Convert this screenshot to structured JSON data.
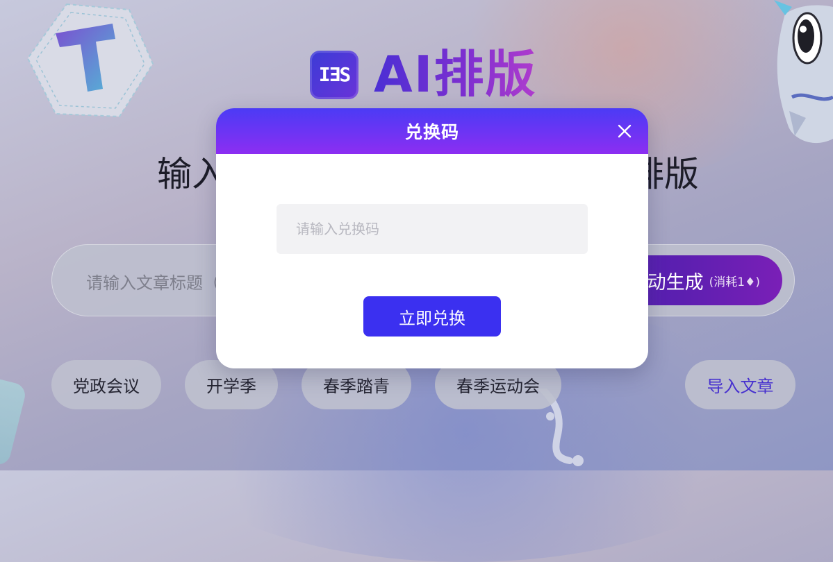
{
  "logo": {
    "icon_text": "ΙƎЅ",
    "title": "AI排版"
  },
  "headline": {
    "left_fragment": "输入",
    "right_fragment": "排版"
  },
  "search": {
    "placeholder": "请输入文章标题（",
    "generate_label": "动生成",
    "generate_cost": "(消耗1♦)"
  },
  "tags": [
    {
      "label": "党政会议"
    },
    {
      "label": "开学季"
    },
    {
      "label": "春季踏青"
    },
    {
      "label": "春季运动会"
    }
  ],
  "import_label": "导入文章",
  "modal": {
    "title": "兑换码",
    "input_placeholder": "请输入兑换码",
    "submit_label": "立即兑换"
  },
  "colors": {
    "accent": "#3b30f0",
    "header_start": "#4b3bf5",
    "header_end": "#8c2ef2"
  }
}
